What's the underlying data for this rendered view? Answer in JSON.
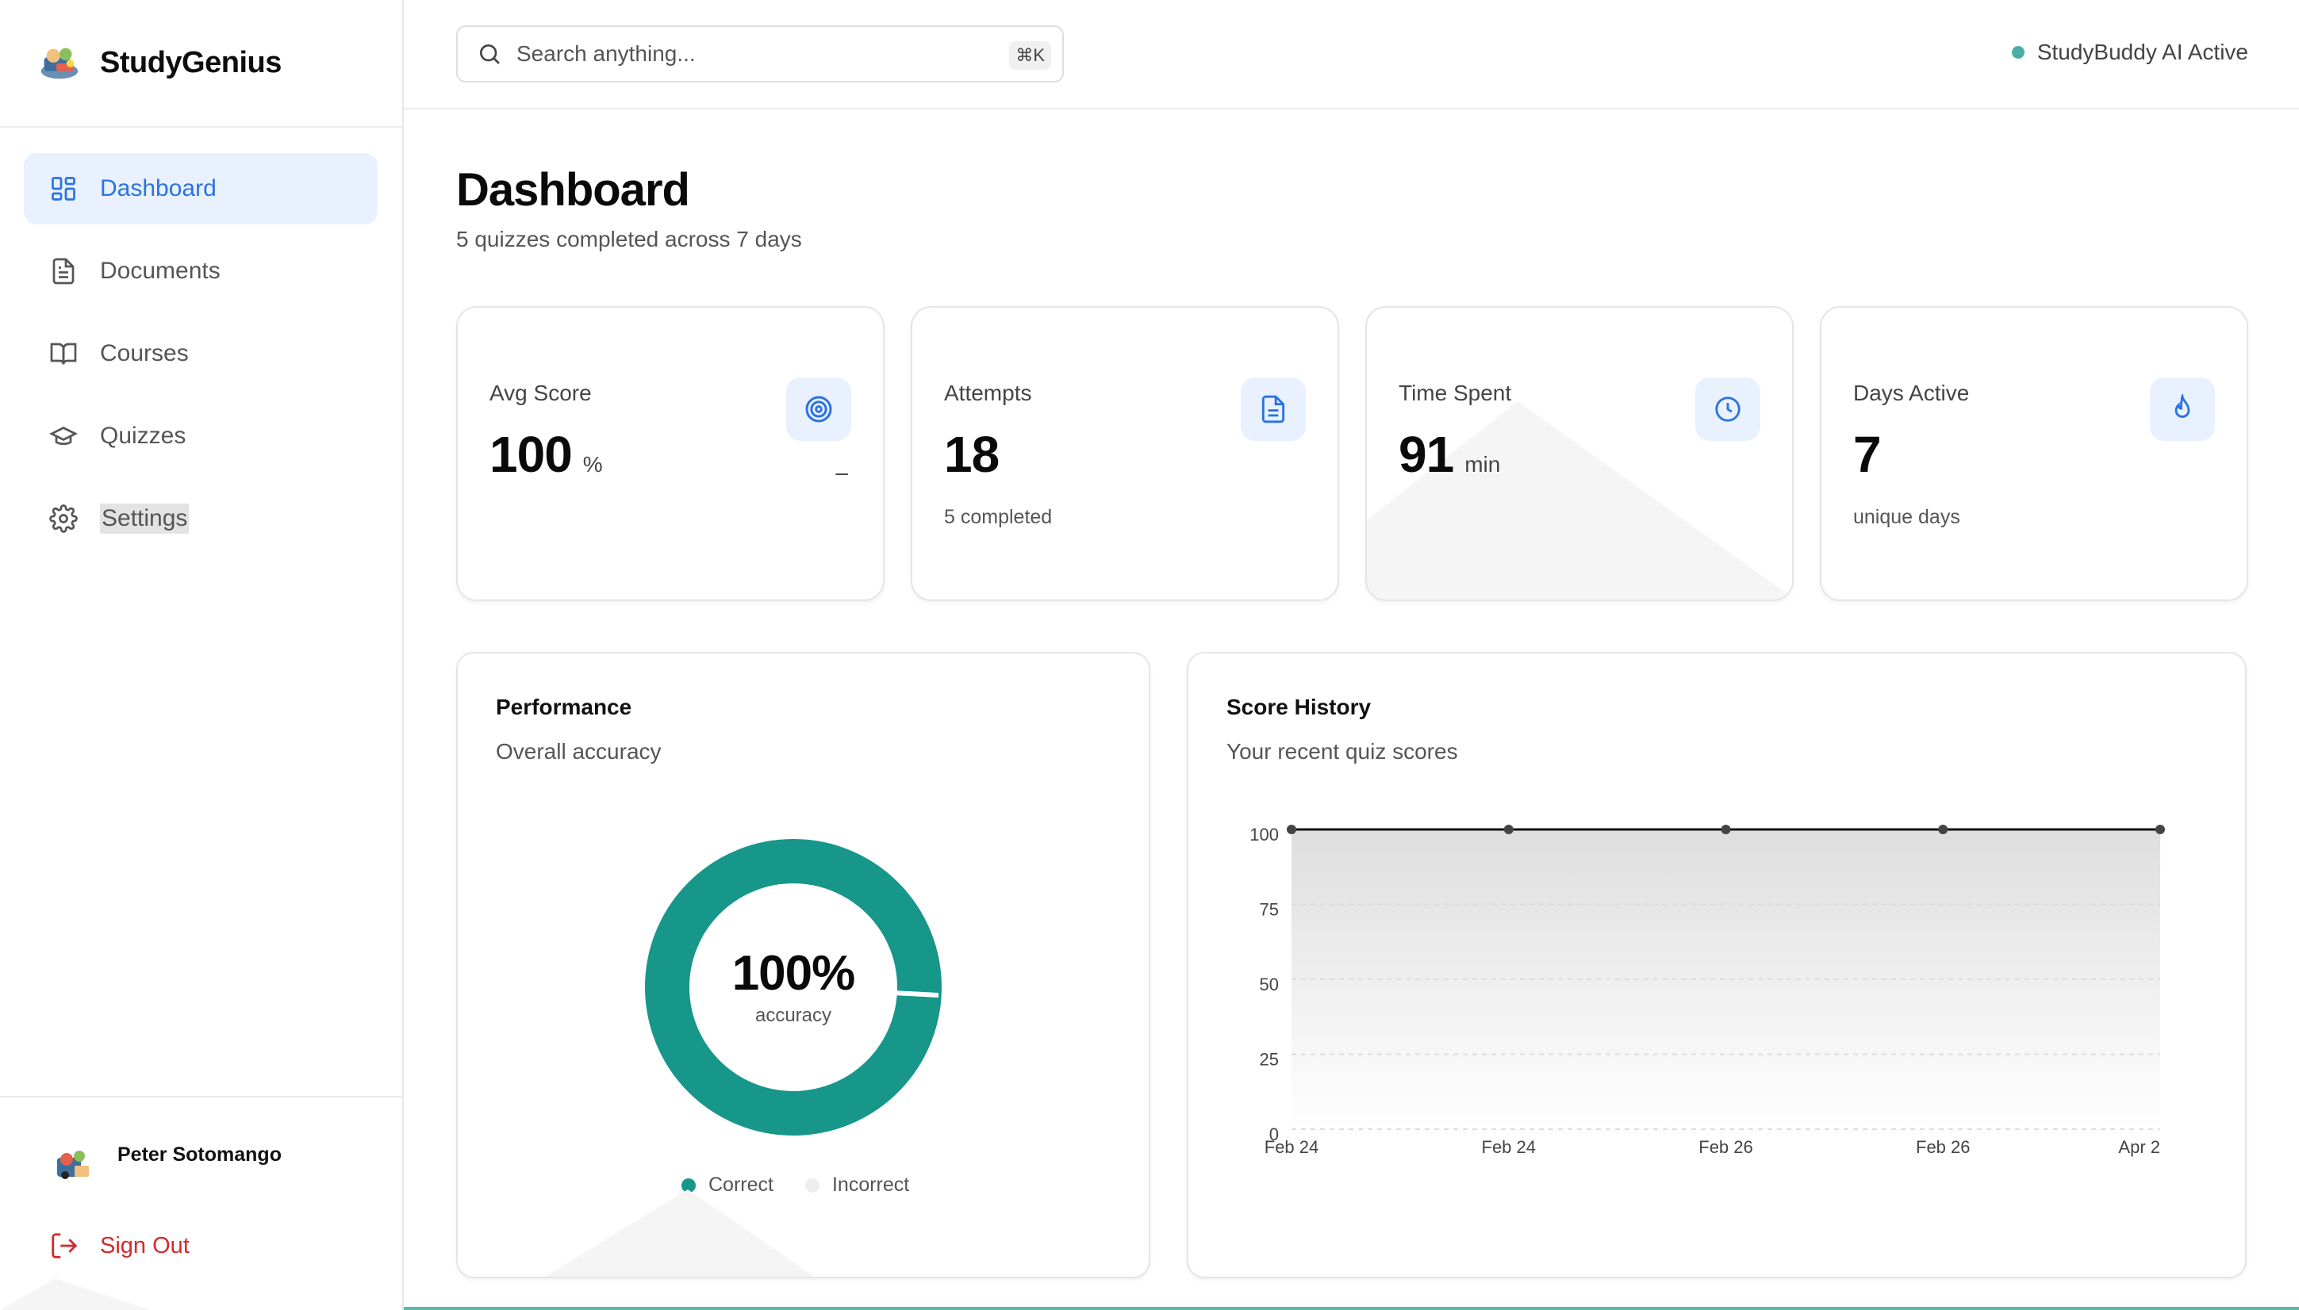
{
  "brand": {
    "name": "StudyGenius"
  },
  "sidebar": {
    "items": [
      {
        "label": "Dashboard",
        "icon": "dashboard-icon",
        "active": true
      },
      {
        "label": "Documents",
        "icon": "document-icon"
      },
      {
        "label": "Courses",
        "icon": "book-icon"
      },
      {
        "label": "Quizzes",
        "icon": "graduation-cap-icon"
      },
      {
        "label": "Settings",
        "icon": "gear-icon"
      }
    ],
    "user": {
      "name": "Peter Sotomango"
    },
    "sign_out": "Sign Out"
  },
  "topbar": {
    "search": {
      "placeholder": "Search anything...",
      "shortcut": "⌘K"
    },
    "ai_status": "StudyBuddy AI Active"
  },
  "page": {
    "title": "Dashboard",
    "subtitle": "5 quizzes completed across 7 days"
  },
  "stats": [
    {
      "label": "Avg Score",
      "value": "100",
      "unit": "%",
      "sub": "",
      "extra": "–",
      "icon": "target-icon"
    },
    {
      "label": "Attempts",
      "value": "18",
      "unit": "",
      "sub": "5 completed",
      "icon": "file-text-icon"
    },
    {
      "label": "Time Spent",
      "value": "91",
      "unit": "min",
      "sub": "",
      "icon": "clock-icon"
    },
    {
      "label": "Days Active",
      "value": "7",
      "unit": "",
      "sub": "unique days",
      "icon": "flame-icon"
    }
  ],
  "performance": {
    "title": "Performance",
    "subtitle": "Overall accuracy",
    "value": "100%",
    "value_label": "accuracy",
    "legend": [
      {
        "label": "Correct",
        "color": "#17968a"
      },
      {
        "label": "Incorrect",
        "color": "#eeeeee"
      }
    ]
  },
  "score_history": {
    "title": "Score History",
    "subtitle": "Your recent quiz scores"
  },
  "colors": {
    "accent": "#2b73e0",
    "teal": "#17968a",
    "danger": "#d42a2a"
  },
  "chart_data": [
    {
      "type": "pie",
      "labels": [
        "Correct",
        "Incorrect"
      ],
      "values": [
        100,
        0
      ]
    },
    {
      "type": "area",
      "categories": [
        "Feb 24",
        "Feb 24",
        "Feb 26",
        "Feb 26",
        "Apr 2"
      ],
      "values": [
        100,
        100,
        100,
        100,
        100
      ],
      "ylim": [
        0,
        100
      ],
      "yticks": [
        0,
        25,
        50,
        75,
        100
      ],
      "grid": true
    }
  ]
}
